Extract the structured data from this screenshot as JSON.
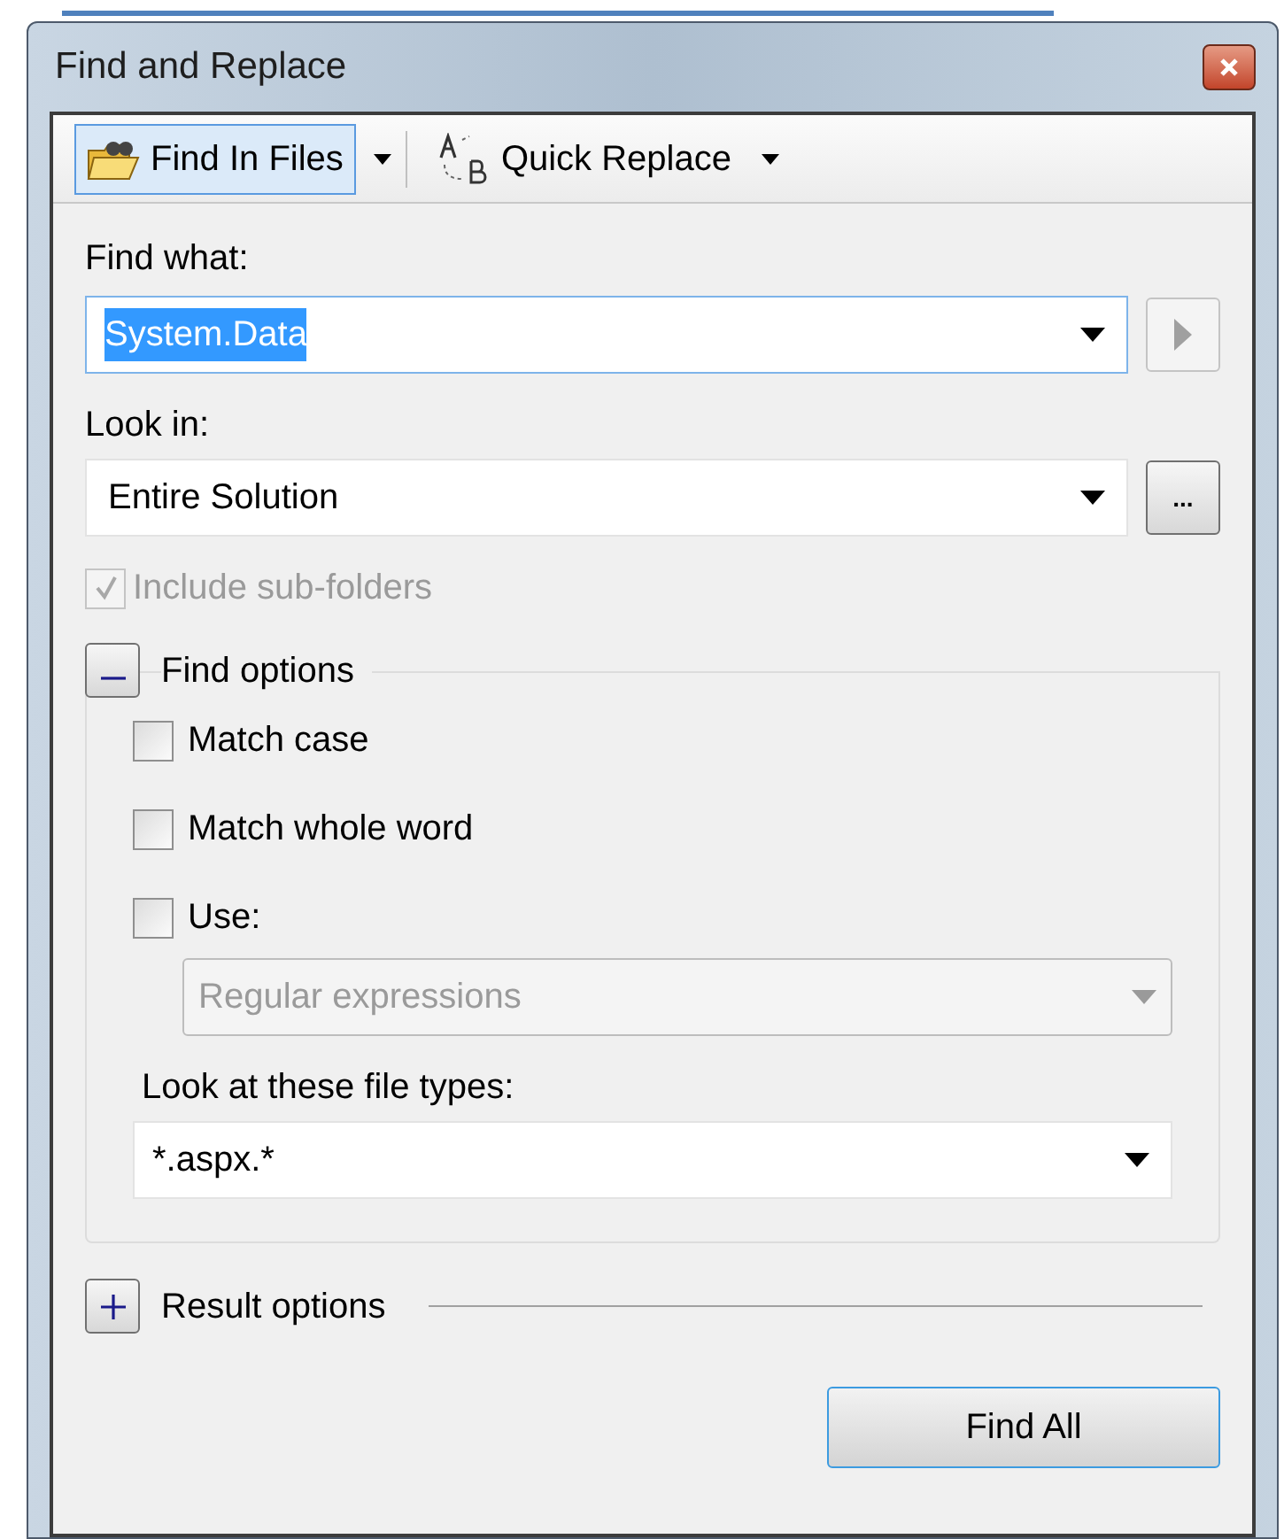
{
  "window": {
    "title": "Find and Replace"
  },
  "toolbar": [
    {
      "kind": "find_in_files",
      "label": "Find In Files",
      "selected": true
    },
    {
      "kind": "quick_replace",
      "label": "Quick Replace",
      "selected": false
    }
  ],
  "find_what": {
    "label": "Find what:",
    "value": "System.Data",
    "text_selected": true
  },
  "look_in": {
    "label": "Look in:",
    "value": "Entire Solution",
    "browse": "..."
  },
  "include_subfolders": {
    "label": "Include sub-folders",
    "checked": true,
    "disabled": true
  },
  "find_options": {
    "title": "Find options",
    "expanded": true,
    "checkboxes": [
      {
        "label": "Match case",
        "checked": false
      },
      {
        "label": "Match whole word",
        "checked": false
      },
      {
        "label": "Use:",
        "checked": false
      }
    ],
    "use_dropdown": {
      "value": "Regular expressions",
      "disabled": true
    },
    "file_types": {
      "label": "Look at these file types:",
      "value": "*.aspx.*"
    }
  },
  "result_options": {
    "title": "Result options",
    "expanded": false
  },
  "buttons": [
    {
      "label": "Find All"
    }
  ]
}
